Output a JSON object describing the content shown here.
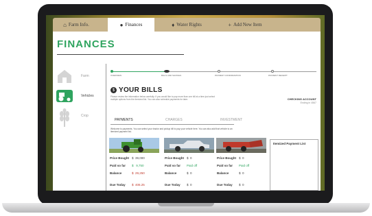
{
  "tabs": [
    {
      "label": "Farm Info.",
      "icon": "barn-icon"
    },
    {
      "label": "Finances",
      "icon": "dollar-icon"
    },
    {
      "label": "Water Rights",
      "icon": "droplet-icon"
    },
    {
      "label": "Add New Item",
      "icon": "plus-icon"
    }
  ],
  "page": {
    "title": "FINANCES"
  },
  "sidebar": {
    "items": [
      {
        "label": "Farm",
        "icon": "barn-icon"
      },
      {
        "label": "Vehicles",
        "icon": "tractor-icon"
      },
      {
        "label": "Crop",
        "icon": "wheat-icon"
      }
    ]
  },
  "progress": {
    "steps": [
      "OVERVIEW",
      "BILLS AND SAVINGS",
      "PAYMENT CONFIRMATION",
      "PAYMENT RECEIPT"
    ],
    "current": 1
  },
  "bills": {
    "title": "YOUR BILLS",
    "intro": "Please review the information below carefully. If you would like to pay more than one bill at a time just select multiple options from the itemized list. You can also schedule payments for later.",
    "account_label": "CHECKING ACCOUNT",
    "account_sub": "Ending in 4567"
  },
  "subtabs": [
    "PAYMENTS",
    "CHARGES",
    "INVESTMENT"
  ],
  "welcome": "Welcome to payments. You can select your tractor and pickup bill to pay your vehicle here. You can also add that vehicle to an itemized payment list.",
  "labels": {
    "price": "Price Bought",
    "paid": "Paid so far",
    "balance": "Balance",
    "due": "Due Today"
  },
  "vehicles": [
    {
      "name": "tractor",
      "price_sym": "$",
      "price": "39,000",
      "paid_sym": "$",
      "paid": "9,750",
      "bal_sym": "$",
      "balance": "29,250",
      "due_sym": "$",
      "due": "406.25"
    },
    {
      "name": "pickup truck",
      "price_sym": "$",
      "price": "0",
      "paid_sym": "",
      "paid": "Paid off",
      "bal_sym": "$",
      "balance": "0",
      "due_sym": "$",
      "due": "0"
    },
    {
      "name": "red tractor",
      "price_sym": "$",
      "price": "0",
      "paid_sym": "",
      "paid": "Paid off",
      "bal_sym": "$",
      "balance": "0",
      "due_sym": "$",
      "due": "0"
    }
  ],
  "itemized": {
    "title": "Itemized Payment List"
  },
  "colors": {
    "accent": "#2fa45f",
    "warning": "#c0392b"
  }
}
